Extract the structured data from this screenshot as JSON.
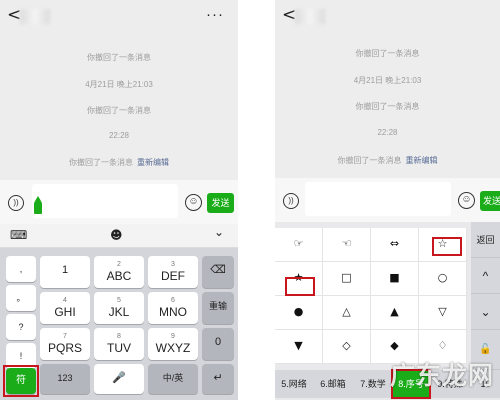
{
  "common": {
    "back_glyph": "<",
    "more_glyph": "···",
    "messages": [
      "你撤回了一条消息",
      "4月21日 晚上21:03",
      "你撤回了一条消息",
      "22:28"
    ],
    "last_recall": "你撤回了一条消息",
    "reedit_label": "重新编辑",
    "send_label": "发送",
    "voice_glyph": "))",
    "emoji_glyph": "☺"
  },
  "left_keyboard": {
    "toolbar_keyboard_glyph": "⌨",
    "toolbar_emoji_glyph": "☻",
    "toolbar_collapse_glyph": "⌄",
    "punct_keys": [
      ",",
      "。",
      "?",
      "!"
    ],
    "keys": [
      {
        "big": "1",
        "small": ""
      },
      {
        "big": "ABC",
        "small": "2"
      },
      {
        "big": "DEF",
        "small": "3"
      },
      {
        "big": "GHI",
        "small": "4"
      },
      {
        "big": "JKL",
        "small": "5"
      },
      {
        "big": "MNO",
        "small": "6"
      },
      {
        "big": "PQRS",
        "small": "7"
      },
      {
        "big": "TUV",
        "small": "8"
      },
      {
        "big": "WXYZ",
        "small": "9"
      }
    ],
    "backspace_glyph": "⌫",
    "reinput_label": "重输",
    "zero_label": "0",
    "symbol_label": "符",
    "num_label": "123",
    "mic_glyph": "🎤",
    "lang_label": "中/英",
    "enter_glyph": "↵"
  },
  "right_keyboard": {
    "symbols": [
      [
        "☞",
        "☜",
        "⇔",
        "☆"
      ],
      [
        "★",
        "□",
        "■",
        "○"
      ],
      [
        "●",
        "△",
        "▲",
        "▽"
      ],
      [
        "▼",
        "◇",
        "◆",
        "♢"
      ]
    ],
    "side_buttons": [
      "返回",
      "^",
      "⌄",
      "🔓"
    ],
    "categories": [
      "5.网络",
      "6.邮箱",
      "7.数学",
      "8.序号",
      "9.特殊",
      "10"
    ],
    "watermark": "广东龙网"
  },
  "colors": {
    "green": "#1aad19",
    "highlight_red": "#c8161e",
    "link_blue": "#576b95"
  }
}
